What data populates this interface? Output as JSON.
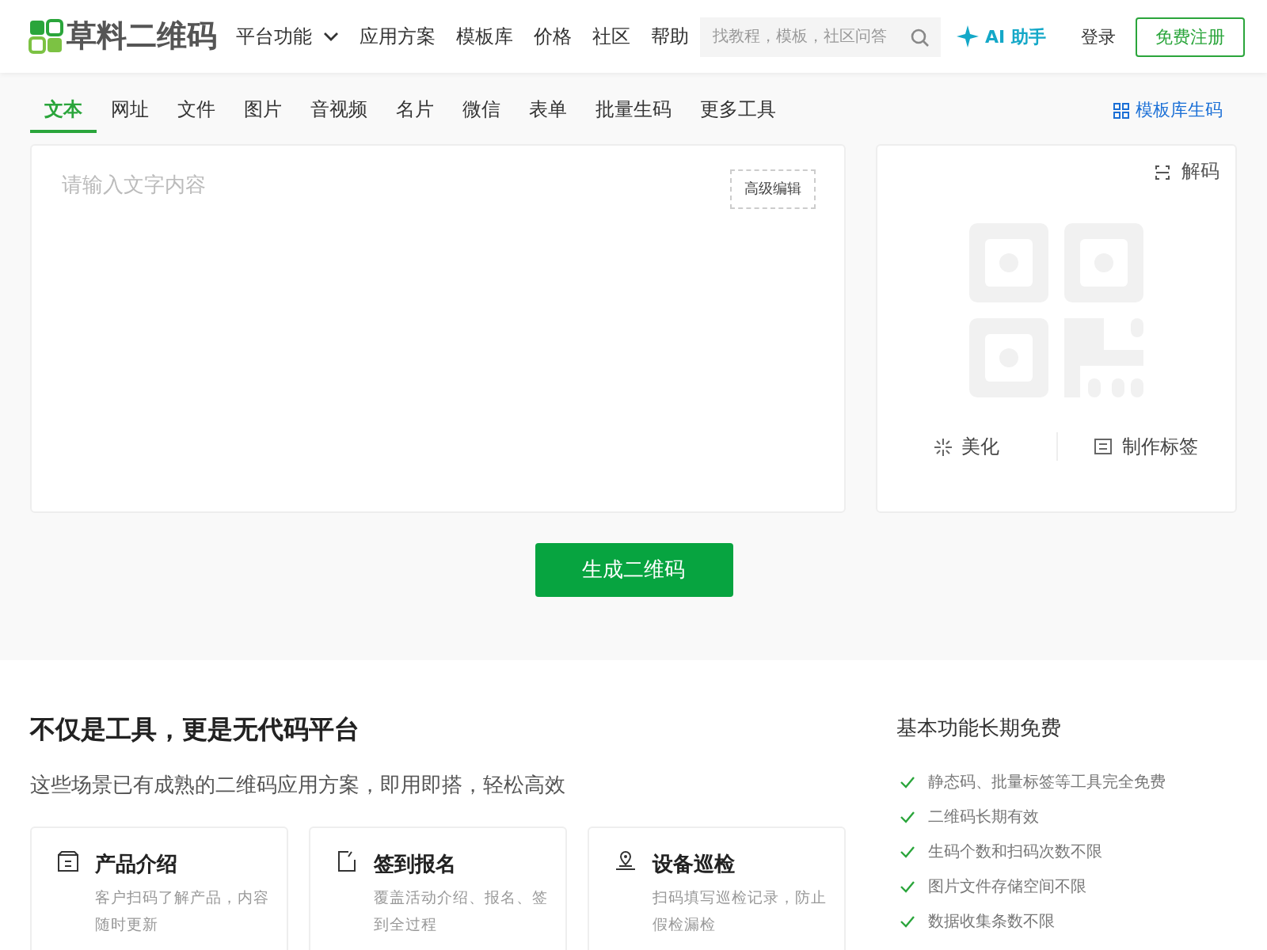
{
  "header": {
    "logo": "草料二维码",
    "nav": [
      {
        "label": "平台功能",
        "dropdown": true
      },
      {
        "label": "应用方案",
        "dropdown": false
      },
      {
        "label": "模板库",
        "dropdown": false
      },
      {
        "label": "价格",
        "dropdown": false
      },
      {
        "label": "社区",
        "dropdown": false
      },
      {
        "label": "帮助",
        "dropdown": false
      }
    ],
    "search": {
      "placeholder": "找教程，模板，社区问答"
    },
    "ai": "AI 助手",
    "login": "登录",
    "signup": "免费注册"
  },
  "tabs": [
    {
      "label": "文本",
      "selected": true
    },
    {
      "label": "网址",
      "selected": false
    },
    {
      "label": "文件",
      "selected": false
    },
    {
      "label": "图片",
      "selected": false
    },
    {
      "label": "音视频",
      "selected": false
    },
    {
      "label": "名片",
      "selected": false
    },
    {
      "label": "微信",
      "selected": false
    },
    {
      "label": "表单",
      "selected": false
    },
    {
      "label": "批量生码",
      "selected": false
    },
    {
      "label": "更多工具",
      "selected": false
    }
  ],
  "template_link": "模板库生码",
  "editor": {
    "placeholder": "请输入文字内容",
    "advanced": "高级编辑"
  },
  "preview": {
    "decode": "解码",
    "actions": [
      "美化",
      "制作标签"
    ]
  },
  "generate": "生成二维码",
  "platform": {
    "title": "不仅是工具，更是无代码平台",
    "subtitle": "这些场景已有成熟的二维码应用方案，即用即搭，轻松高效",
    "cards": [
      {
        "title": "产品介绍",
        "desc": "客户扫码了解产品，内容随时更新"
      },
      {
        "title": "签到报名",
        "desc": "覆盖活动介绍、报名、签到全过程"
      },
      {
        "title": "设备巡检",
        "desc": "扫码填写巡检记录，防止假检漏检"
      }
    ]
  },
  "free": {
    "title": "基本功能长期免费",
    "items": [
      "静态码、批量标签等工具完全免费",
      "二维码长期有效",
      "生码个数和扫码次数不限",
      "图片文件存储空间不限",
      "数据收集条数不限"
    ]
  }
}
